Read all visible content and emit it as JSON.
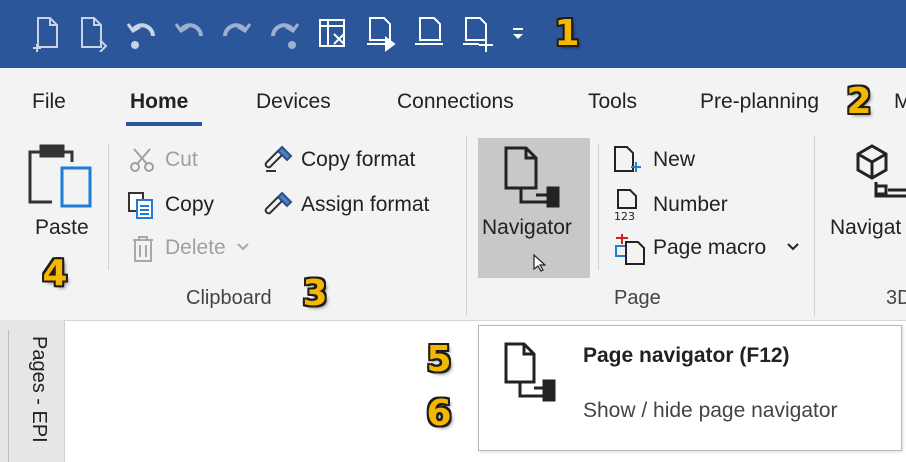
{
  "colors": {
    "titlebar": "#2b579a",
    "ribbon_bg": "#f3f3f3",
    "accent": "#2b579a",
    "callout": "#f5b800",
    "selected_button": "#c8c8c8"
  },
  "quick_access": {
    "icons": [
      "new-page-icon",
      "new-page-variant-icon",
      "undo-list-icon",
      "undo-icon",
      "redo-icon",
      "redo-list-icon",
      "delete-table-icon",
      "page-forward-icon",
      "page-icon",
      "page-add-icon"
    ],
    "dropdown": "customize-dropdown-icon"
  },
  "tabs": [
    "File",
    "Home",
    "Devices",
    "Connections",
    "Tools",
    "Pre-planning",
    "M"
  ],
  "ribbon": {
    "clipboard": {
      "paste": "Paste",
      "cut": "Cut",
      "copy": "Copy",
      "delete": "Delete",
      "copy_format": "Copy format",
      "assign_format": "Assign format",
      "label": "Clipboard"
    },
    "page": {
      "navigator": "Navigator",
      "new": "New",
      "number": "Number",
      "page_macro": "Page macro",
      "label": "Page"
    },
    "3d": {
      "navigator": "Navigat",
      "label": "3D"
    }
  },
  "sidebar": {
    "label": "Pages - EPI"
  },
  "tooltip": {
    "title": "Page navigator (F12)",
    "description": "Show / hide page navigator"
  },
  "callouts": [
    "1",
    "2",
    "3",
    "4",
    "5",
    "6"
  ]
}
